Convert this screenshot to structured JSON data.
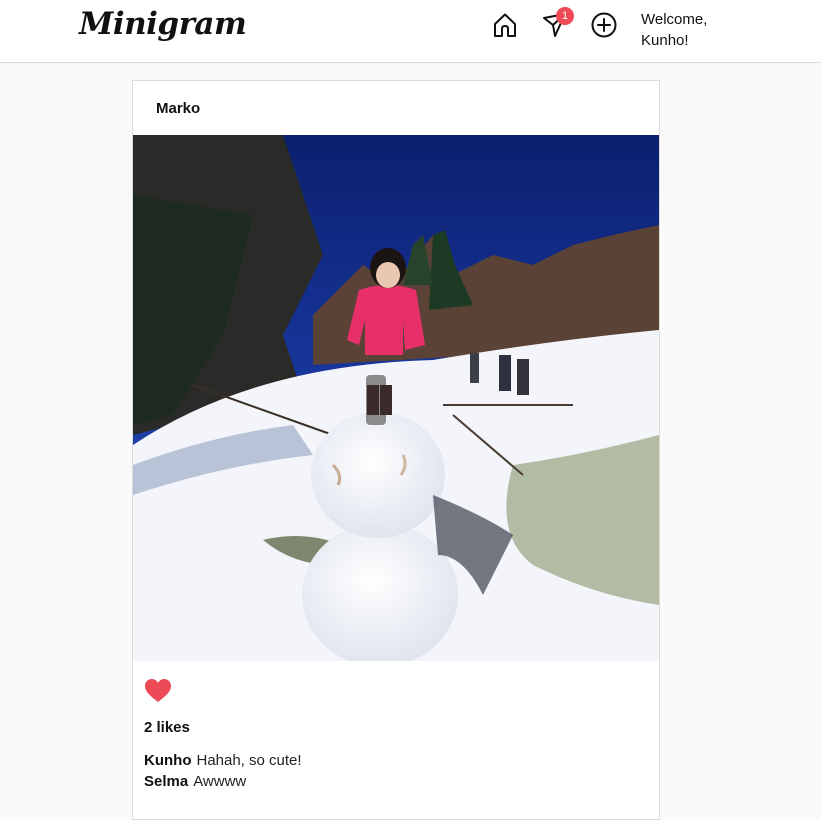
{
  "app": {
    "logo": "Minigram"
  },
  "header": {
    "icons": [
      "home-icon",
      "send-icon",
      "add-icon"
    ],
    "notification_count": "1",
    "welcome_line1": "Welcome,",
    "welcome_line2": "Kunho!"
  },
  "post": {
    "username": "Marko",
    "likes_text": "2 likes",
    "comments": [
      {
        "user": "Kunho",
        "text": "Hahah, so cute!"
      },
      {
        "user": "Selma",
        "text": "Awwww"
      }
    ]
  },
  "colors": {
    "like": "#ed4956",
    "badge": "#ed4956",
    "sky": "#0f2a82"
  }
}
